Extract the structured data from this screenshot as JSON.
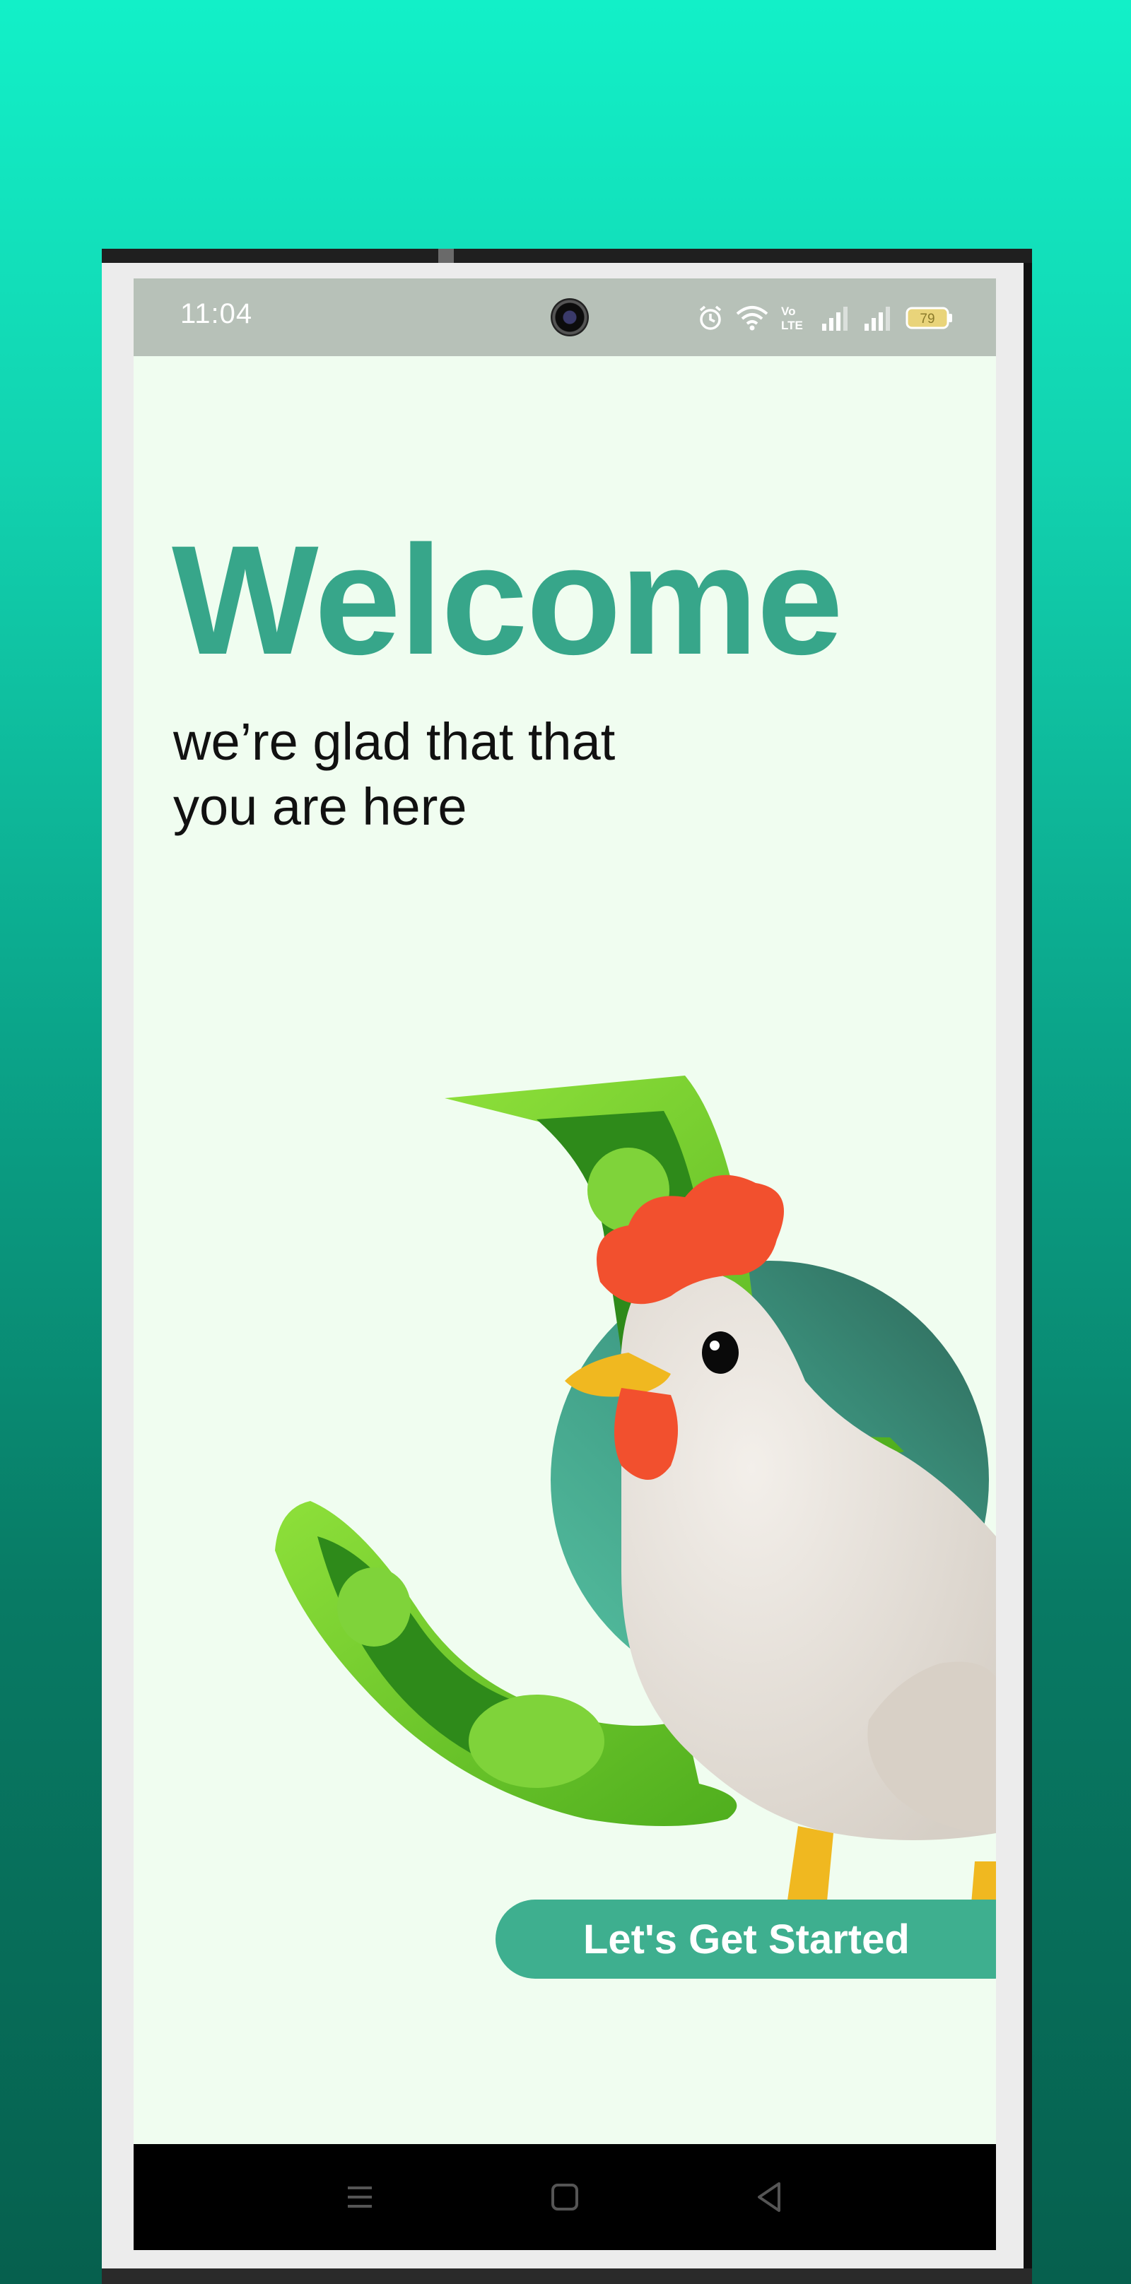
{
  "status_bar": {
    "time": "11:04",
    "icons": [
      "alarm-icon",
      "wifi-icon",
      "volte-icon",
      "signal-icon",
      "signal-icon",
      "battery-icon"
    ],
    "battery_level": "79"
  },
  "main": {
    "title": "Welcome",
    "subtitle": "we’re glad that that you are here",
    "cta_label": "Let's Get Started"
  },
  "illustration": {
    "icons": [
      "money-bill-icon",
      "rooster-icon",
      "circle-backdrop"
    ]
  },
  "nav_bar": {
    "icons": [
      "recents-icon",
      "home-icon",
      "back-icon"
    ]
  },
  "colors": {
    "background_top": "#12f0c8",
    "background_bottom": "#06604e",
    "screen": "#f0fdf0",
    "accent": "#37a68a",
    "button": "#3eaf8f",
    "status_bar": "#b7c1b8"
  }
}
